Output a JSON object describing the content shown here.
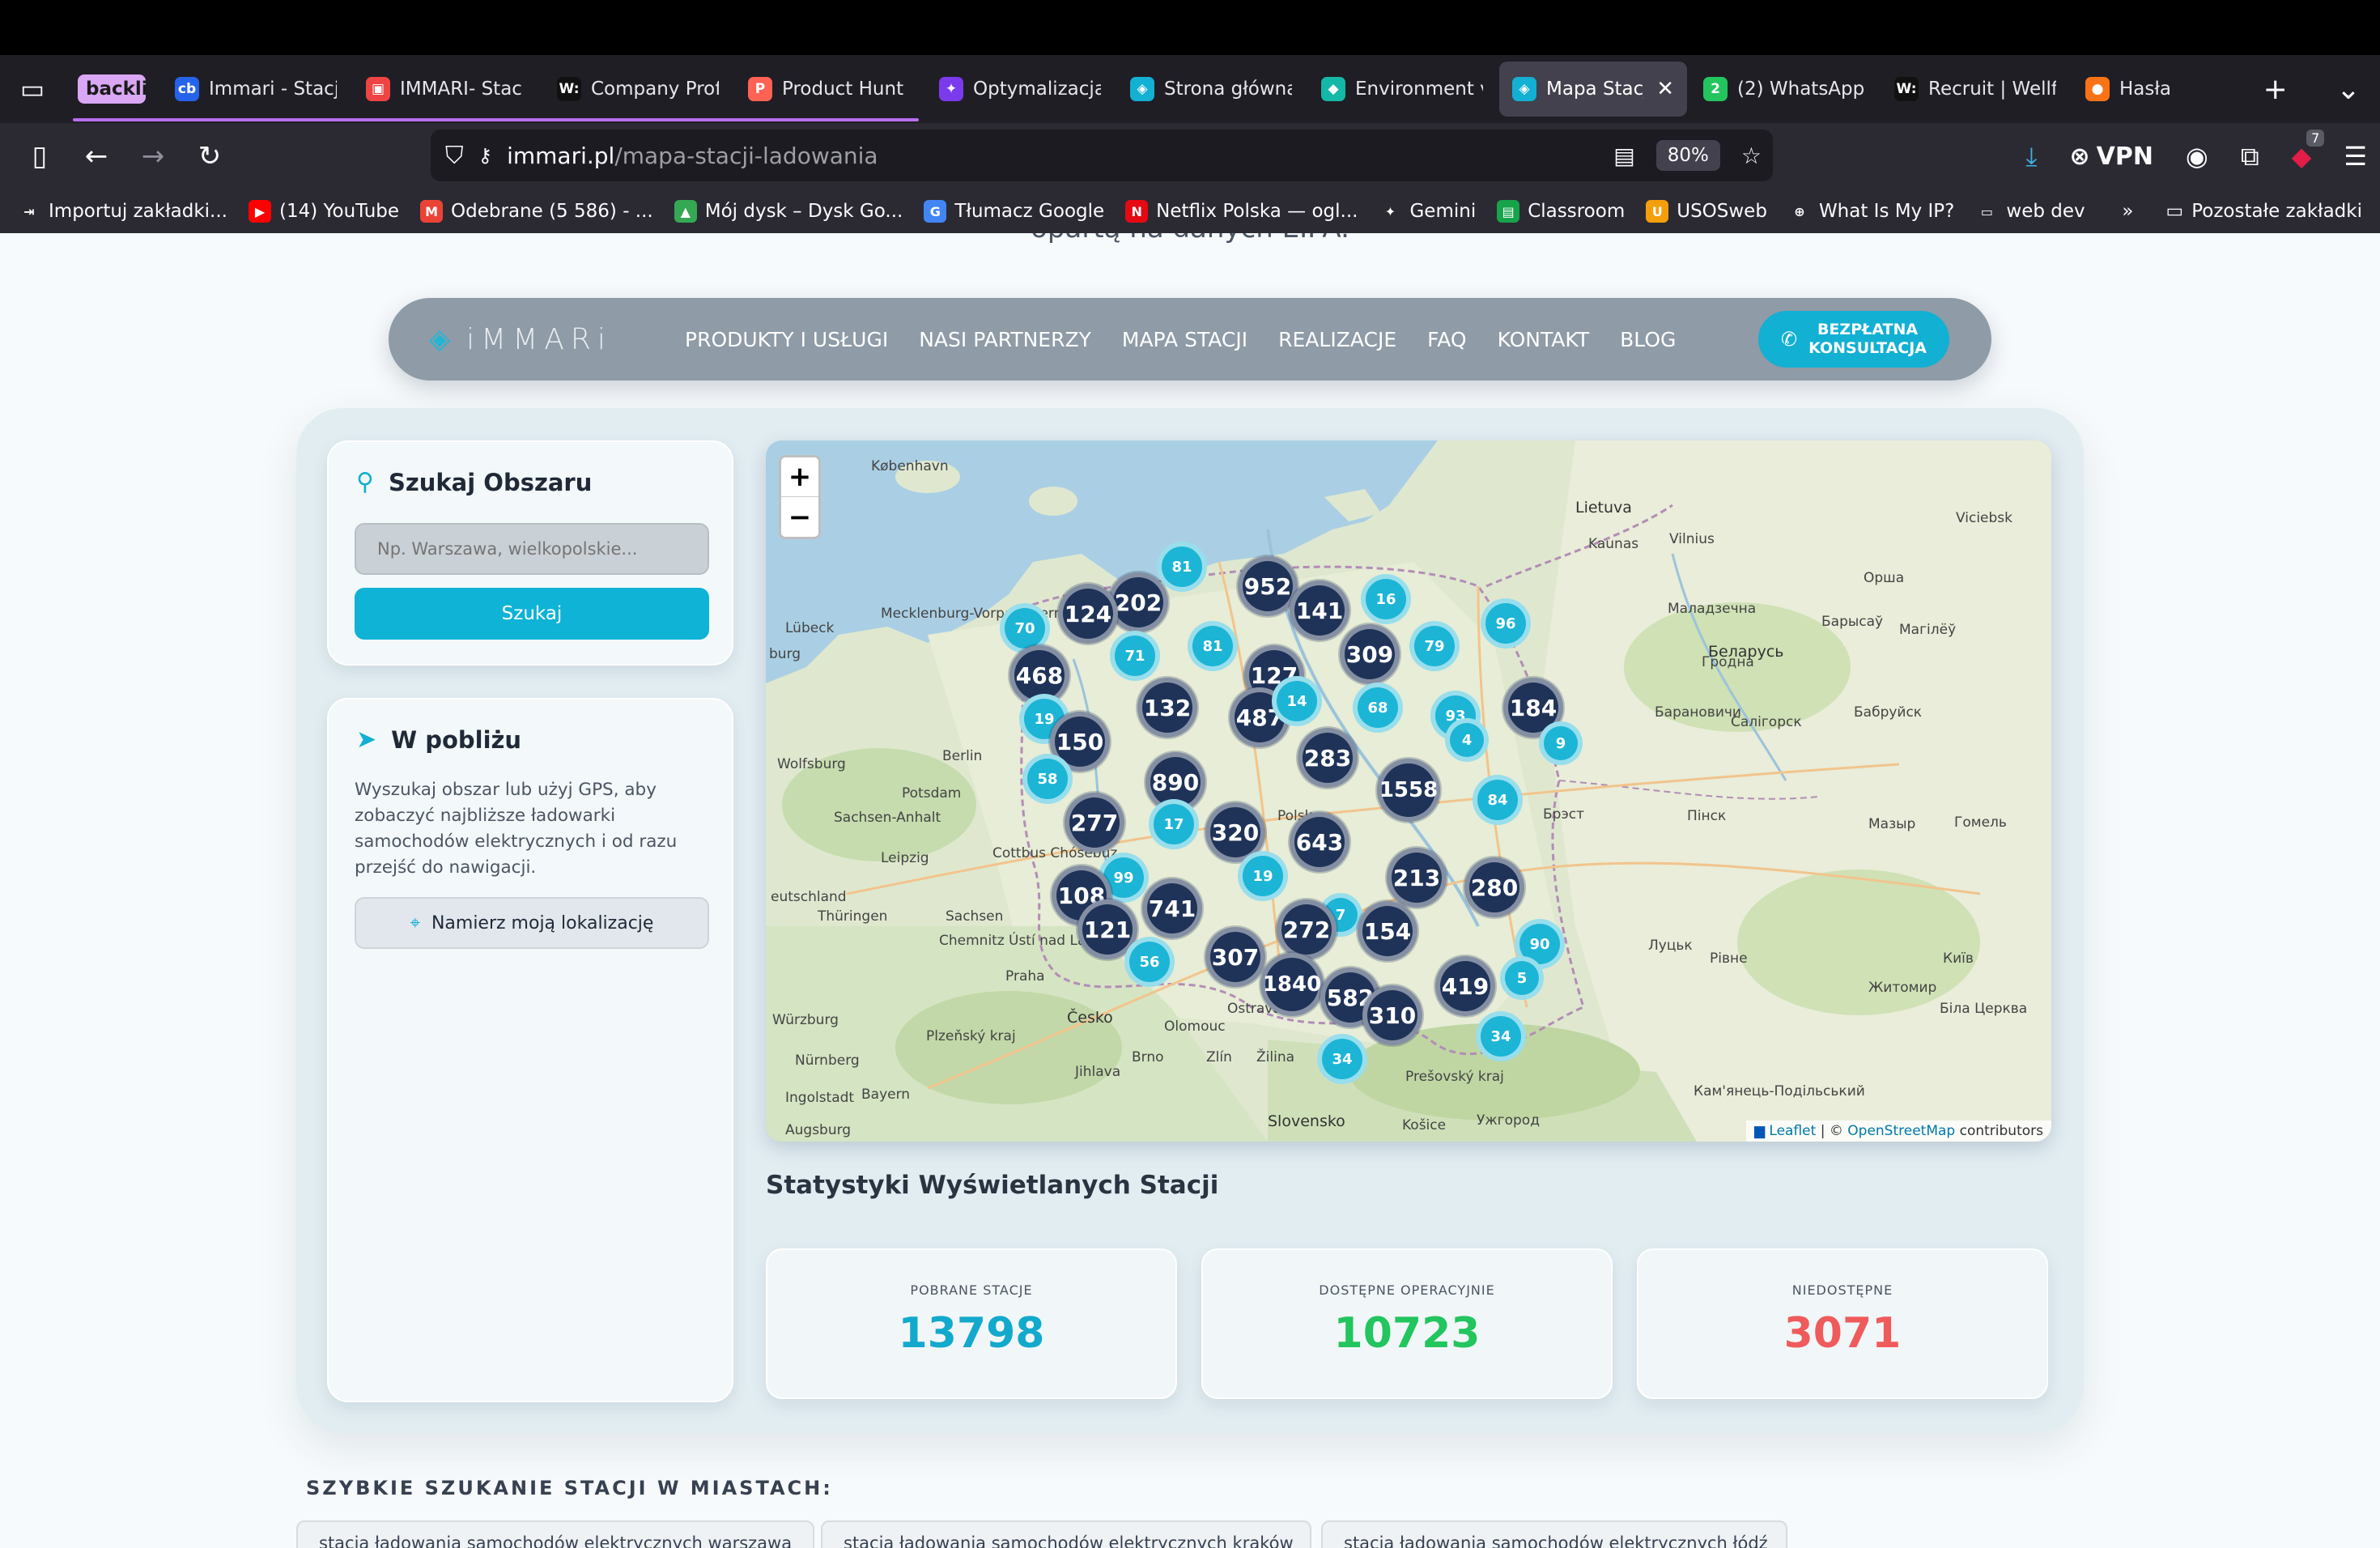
{
  "browser": {
    "tabs": [
      {
        "title": "backlinki",
        "pinned": true,
        "favicon": "",
        "fav_color": ""
      },
      {
        "title": "Immari - Stacj",
        "favicon": "cb",
        "fav_color": "#2563eb"
      },
      {
        "title": "IMMARI- Stac",
        "favicon": "▣",
        "fav_color": "#ef4444"
      },
      {
        "title": "Company Prof",
        "favicon": "W:",
        "fav_color": "#111111"
      },
      {
        "title": "Product Hunt",
        "favicon": "P",
        "fav_color": "#ff6154"
      },
      {
        "title": "Optymalizacja",
        "favicon": "✦",
        "fav_color": "#7c3aed"
      },
      {
        "title": "Strona główna",
        "favicon": "◈",
        "fav_color": "#12b0d3"
      },
      {
        "title": "Environment v",
        "favicon": "◆",
        "fav_color": "#14b8a6"
      },
      {
        "title": "Mapa Stacj",
        "favicon": "◈",
        "fav_color": "#12b0d3",
        "active": true
      },
      {
        "title": "(2) WhatsApp",
        "favicon": "2",
        "fav_color": "#22c55e"
      },
      {
        "title": "Recruit | Wellf",
        "favicon": "W:",
        "fav_color": "#111111"
      },
      {
        "title": "Hasła",
        "favicon": "●",
        "fav_color": "#f97316"
      }
    ],
    "url_host": "immari.pl",
    "url_path": "/mapa-stacji-ladowania",
    "zoom": "80%",
    "vpn_label": "VPN",
    "ext_badge": "7",
    "bookmarks": [
      {
        "label": "Importuj zakładki...",
        "icon": "⇥",
        "color": "transparent"
      },
      {
        "label": "(14) YouTube",
        "icon": "▶",
        "color": "#ff0000"
      },
      {
        "label": "Odebrane (5 586) - ...",
        "icon": "M",
        "color": "#ea4335"
      },
      {
        "label": "Mój dysk – Dysk Go...",
        "icon": "▲",
        "color": "#34a853"
      },
      {
        "label": "Tłumacz Google",
        "icon": "G",
        "color": "#4285f4"
      },
      {
        "label": "Netflix Polska — ogl...",
        "icon": "N",
        "color": "#e50914"
      },
      {
        "label": "Gemini",
        "icon": "✦",
        "color": "transparent"
      },
      {
        "label": "Classroom",
        "icon": "▤",
        "color": "#16a34a"
      },
      {
        "label": "USOSweb",
        "icon": "U",
        "color": "#f59e0b"
      },
      {
        "label": "What Is My IP?",
        "icon": "⊕",
        "color": "transparent"
      },
      {
        "label": "web dev",
        "icon": "▭",
        "color": "transparent"
      }
    ],
    "other_bookmarks": "Pozostałe zakładki"
  },
  "site": {
    "cut_text": "opartą na danych EIPA.",
    "logo": "iMMARi",
    "menu": [
      "PRODUKTY I USŁUGI",
      "NASI PARTNERZY",
      "MAPA STACJI",
      "REALIZACJE",
      "FAQ",
      "KONTAKT",
      "BLOG"
    ],
    "cta_line1": "BEZPŁATNA",
    "cta_line2": "KONSULTACJA"
  },
  "search": {
    "title": "Szukaj Obszaru",
    "placeholder": "Np. Warszawa, wielkopolskie...",
    "button": "Szukaj"
  },
  "nearby": {
    "title": "W pobliżu",
    "description": "Wyszukaj obszar lub użyj GPS, aby zobaczyć najbliższe ładowarki samochodów elektrycznych i od razu przejść do nawigacji.",
    "button": "Namierz moją lokalizację"
  },
  "map": {
    "zoom_in": "+",
    "zoom_out": "−",
    "attribution_leaflet": "Leaflet",
    "attribution_sep": " | © ",
    "attribution_osm": "OpenStreetMap",
    "attribution_tail": " contributors",
    "clusters": [
      {
        "label": "81",
        "size": "small"
      },
      {
        "label": "952",
        "size": "big"
      },
      {
        "label": "202",
        "size": "big"
      },
      {
        "label": "124",
        "size": "big"
      },
      {
        "label": "70",
        "size": "small"
      },
      {
        "label": "141",
        "size": "big"
      },
      {
        "label": "16",
        "size": "small"
      },
      {
        "label": "96",
        "size": "small"
      },
      {
        "label": "71",
        "size": "small"
      },
      {
        "label": "81",
        "size": "small"
      },
      {
        "label": "309",
        "size": "big"
      },
      {
        "label": "79",
        "size": "small"
      },
      {
        "label": "127",
        "size": "big"
      },
      {
        "label": "468",
        "size": "big"
      },
      {
        "label": "132",
        "size": "big"
      },
      {
        "label": "487",
        "size": "big"
      },
      {
        "label": "14",
        "size": "small"
      },
      {
        "label": "68",
        "size": "small"
      },
      {
        "label": "93",
        "size": "small"
      },
      {
        "label": "184",
        "size": "big"
      },
      {
        "label": "19",
        "size": "small"
      },
      {
        "label": "150",
        "size": "big"
      },
      {
        "label": "4",
        "size": "small"
      },
      {
        "label": "9",
        "size": "small"
      },
      {
        "label": "283",
        "size": "big"
      },
      {
        "label": "58",
        "size": "small"
      },
      {
        "label": "890",
        "size": "big"
      },
      {
        "label": "1558",
        "size": "big"
      },
      {
        "label": "84",
        "size": "small"
      },
      {
        "label": "277",
        "size": "big"
      },
      {
        "label": "17",
        "size": "small"
      },
      {
        "label": "320",
        "size": "big"
      },
      {
        "label": "643",
        "size": "big"
      },
      {
        "label": "19",
        "size": "small"
      },
      {
        "label": "213",
        "size": "big"
      },
      {
        "label": "280",
        "size": "big"
      },
      {
        "label": "99",
        "size": "small"
      },
      {
        "label": "108",
        "size": "big"
      },
      {
        "label": "741",
        "size": "big"
      },
      {
        "label": "7",
        "size": "small"
      },
      {
        "label": "121",
        "size": "big"
      },
      {
        "label": "272",
        "size": "big"
      },
      {
        "label": "154",
        "size": "big"
      },
      {
        "label": "90",
        "size": "small"
      },
      {
        "label": "56",
        "size": "small"
      },
      {
        "label": "307",
        "size": "big"
      },
      {
        "label": "5",
        "size": "small"
      },
      {
        "label": "1840",
        "size": "big"
      },
      {
        "label": "582",
        "size": "big"
      },
      {
        "label": "419",
        "size": "big"
      },
      {
        "label": "310",
        "size": "big"
      },
      {
        "label": "34",
        "size": "small"
      },
      {
        "label": "34",
        "size": "small"
      }
    ],
    "place_labels": [
      "København",
      "Lietuva",
      "Vilnius",
      "Kaunas",
      "Viciebsk",
      "Lübeck",
      "Mecklenburg-Vorpommern",
      "burg",
      "Berlin",
      "Potsdam",
      "Wolfsburg",
      "Sachsen-Anhalt",
      "Leipzig",
      "Cottbus Chóśebuz",
      "eutschland",
      "Thüringen",
      "Sachsen",
      "Chemnitz",
      "Ústí nad Labem",
      "Praha",
      "Česko",
      "Würzburg",
      "Nürnberg",
      "Ingolstadt",
      "Augsburg",
      "Bayern",
      "Plzeňský kraj",
      "Jihlava",
      "Brno",
      "Olomouc",
      "Ostrava",
      "Zlín",
      "Žilina",
      "Slovensko",
      "Košice",
      "Prešovský kraj",
      "Беларусь",
      "Гродна",
      "Барановичи",
      "Салігорск",
      "Бабруйск",
      "Брэст",
      "Пінск",
      "Гомель",
      "Мазыр",
      "Луцьк",
      "Рівне",
      "Житомир",
      "Київ",
      "Біла Церква",
      "Ужгород",
      "Кам'янець-Подільський",
      "Маладзечна",
      "Барысаў",
      "Магілёў",
      "Орша",
      "Polska"
    ]
  },
  "stats": {
    "title": "Statystyki Wyświetlanych Stacji",
    "items": [
      {
        "label": "POBRANE STACJE",
        "value": "13798",
        "color": "#12a9cc"
      },
      {
        "label": "DOSTĘPNE OPERACYJNIE",
        "value": "10723",
        "color": "#22c55e"
      },
      {
        "label": "NIEDOSTĘPNE",
        "value": "3071",
        "color": "#ef5b5b"
      }
    ]
  },
  "quick": {
    "title": "SZYBKIE SZUKANIE STACJI W MIASTACH:",
    "pills": [
      "stacja ładowania samochodów elektrycznych warszawa",
      "stacja ładowania samochodów elektrycznych kraków",
      "stacja ładowania samochodów elektrycznych łódź"
    ]
  }
}
